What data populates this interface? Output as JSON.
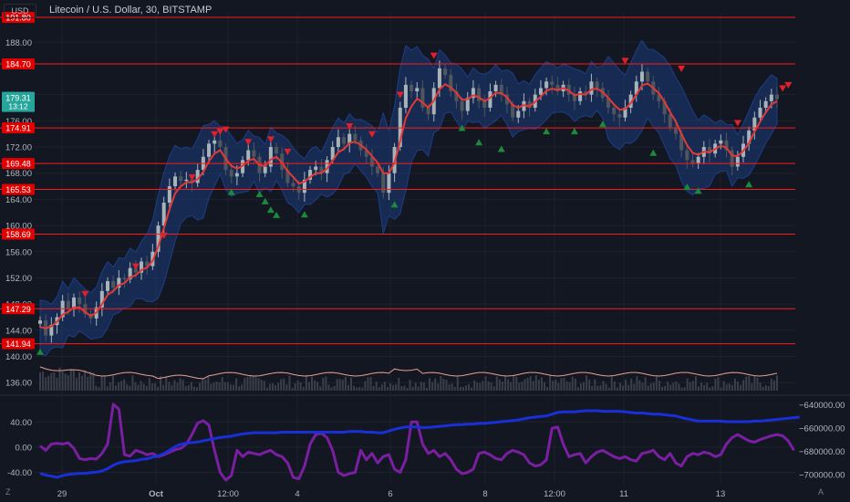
{
  "header": {
    "symbol_title": "Litecoin / U.S. Dollar, 30, BITSTAMP",
    "currency_button": "USD"
  },
  "footer": {
    "z_button": "Z",
    "a_button": "A"
  },
  "colors": {
    "background": "#131722",
    "grid": "#1e222d",
    "candle_up": "#a8b3b8",
    "candle_down": "#50555e",
    "ma_line": "#e53935",
    "band_fill": "#1c3c7a",
    "level_line": "#ff1a1a",
    "level_tag": "#e00000",
    "current_tag": "#26a69a",
    "osc_purple": "#7b1fa2",
    "osc_blue": "#1a2fd6",
    "volume_line": "#e8a090"
  },
  "chart_data": {
    "type": "line",
    "main_axis": {
      "ticks": [
        "188.00",
        "180.00",
        "176.00",
        "172.00",
        "168.00",
        "164.00",
        "160.00",
        "156.00",
        "152.00",
        "148.00",
        "144.00",
        "140.00",
        "136.00"
      ],
      "range": [
        134.5,
        192.5
      ]
    },
    "horizontal_levels": [
      191.8,
      184.7,
      174.91,
      169.48,
      165.53,
      158.69,
      147.29,
      141.94
    ],
    "current_price": {
      "value": "179.31",
      "countdown": "13:12"
    },
    "x_labels": [
      "29",
      "Oct",
      "12:00",
      "4",
      "6",
      "8",
      "12:00",
      "11",
      "13"
    ],
    "price_series": [
      145.5,
      143.2,
      144.8,
      146.0,
      148.5,
      147.2,
      149.0,
      148.0,
      146.5,
      145.8,
      147.5,
      150.0,
      151.5,
      150.5,
      152.0,
      151.8,
      153.5,
      152.8,
      154.5,
      153.8,
      156.0,
      160.0,
      163.5,
      166.0,
      167.5,
      166.8,
      167.0,
      166.5,
      168.5,
      170.5,
      172.5,
      173.0,
      172.0,
      168.5,
      167.5,
      168.0,
      170.0,
      171.5,
      170.5,
      168.0,
      169.0,
      172.0,
      171.0,
      168.5,
      166.5,
      166.0,
      165.0,
      167.0,
      168.5,
      169.0,
      168.0,
      170.0,
      172.0,
      173.5,
      172.5,
      174.0,
      173.0,
      171.5,
      170.5,
      169.0,
      168.0,
      165.0,
      168.0,
      172.0,
      178.0,
      181.5,
      180.5,
      181.0,
      178.0,
      177.0,
      181.0,
      184.0,
      183.0,
      180.5,
      179.0,
      177.5,
      179.5,
      181.0,
      179.0,
      178.0,
      180.5,
      181.5,
      180.0,
      178.5,
      176.5,
      177.5,
      179.0,
      178.0,
      180.0,
      181.0,
      182.0,
      181.5,
      180.5,
      181.5,
      180.0,
      179.0,
      180.5,
      180.0,
      182.0,
      181.0,
      179.5,
      178.0,
      177.0,
      176.5,
      178.0,
      180.0,
      182.0,
      183.5,
      182.0,
      180.0,
      179.0,
      177.0,
      175.0,
      174.0,
      171.5,
      170.0,
      169.5,
      170.5,
      172.0,
      171.0,
      172.5,
      173.0,
      171.5,
      169.0,
      170.5,
      172.5,
      174.5,
      176.5,
      178.0,
      179.0,
      180.0,
      179.3
    ],
    "ma_series": [
      144.5,
      144.3,
      144.6,
      145.3,
      146.4,
      146.8,
      147.5,
      147.5,
      146.8,
      146.2,
      146.7,
      148.0,
      149.4,
      150.0,
      150.9,
      151.2,
      152.1,
      152.4,
      153.2,
      153.6,
      154.6,
      156.8,
      159.6,
      162.5,
      164.9,
      166.0,
      166.6,
      166.6,
      167.1,
      168.2,
      169.8,
      171.0,
      171.5,
      170.2,
      169.1,
      168.7,
      169.1,
      169.9,
      170.2,
      169.2,
      169.1,
      170.1,
      170.5,
      169.6,
      168.3,
      167.4,
      166.4,
      166.7,
      167.4,
      168.0,
      168.0,
      168.7,
      169.9,
      171.2,
      171.7,
      172.6,
      172.8,
      172.3,
      171.6,
      170.6,
      169.6,
      168.0,
      168.0,
      169.6,
      172.9,
      176.4,
      178.2,
      179.4,
      178.8,
      178.0,
      179.1,
      180.8,
      181.6,
      181.1,
      180.3,
      179.2,
      179.3,
      179.9,
      179.6,
      179.0,
      179.5,
      180.3,
      180.2,
      179.6,
      178.4,
      178.0,
      178.4,
      178.2,
      178.9,
      179.7,
      180.6,
      180.9,
      180.7,
      181.0,
      180.6,
      179.9,
      180.1,
      180.0,
      180.8,
      180.9,
      180.4,
      179.5,
      178.5,
      177.7,
      177.8,
      178.7,
      180.0,
      181.4,
      181.7,
      181.0,
      180.2,
      178.9,
      177.3,
      175.9,
      174.0,
      172.3,
      171.1,
      170.8,
      171.3,
      171.2,
      171.7,
      172.2,
      171.9,
      170.7,
      170.6,
      171.4,
      172.6,
      174.3,
      175.9,
      177.3,
      178.5,
      179.0
    ],
    "markers": {
      "sell": [
        [
          8,
          149.6
        ],
        [
          17,
          153.8
        ],
        [
          22,
          158.5
        ],
        [
          27,
          167.4
        ],
        [
          31,
          174.0
        ],
        [
          32,
          174.4
        ],
        [
          33,
          174.7
        ],
        [
          37,
          172.8
        ],
        [
          41,
          173.2
        ],
        [
          44,
          171.3
        ],
        [
          55,
          175.2
        ],
        [
          59,
          174.0
        ],
        [
          64,
          180.0
        ],
        [
          70,
          186.0
        ],
        [
          104,
          185.2
        ],
        [
          114,
          184.0
        ],
        [
          124,
          175.7
        ],
        [
          132,
          181.0
        ],
        [
          133,
          181.5
        ]
      ],
      "buy": [
        [
          0,
          140.8
        ],
        [
          34,
          165.2
        ],
        [
          39,
          164.9
        ],
        [
          40,
          163.8
        ],
        [
          41,
          162.5
        ],
        [
          42,
          161.7
        ],
        [
          47,
          161.8
        ],
        [
          63,
          163.3
        ],
        [
          75,
          175.0
        ],
        [
          78,
          172.8
        ],
        [
          82,
          171.8
        ],
        [
          90,
          174.5
        ],
        [
          95,
          174.5
        ],
        [
          100,
          175.6
        ],
        [
          109,
          171.2
        ],
        [
          115,
          166.0
        ],
        [
          117,
          165.4
        ],
        [
          126,
          166.4
        ]
      ]
    },
    "osc_axis": {
      "ticks": [
        "40.00",
        "0.00",
        "-40.00"
      ],
      "range": [
        -58,
        78
      ]
    },
    "osc_right_axis": {
      "ticks": [
        "640000.00",
        "660000.00",
        "680000.00",
        "700000.00"
      ],
      "range": [
        -708000,
        -634000
      ]
    },
    "oscillator_series": [
      2,
      -5,
      5,
      6,
      5,
      7,
      -2,
      -18,
      -20,
      -18,
      -19,
      -10,
      5,
      68,
      60,
      -12,
      -14,
      -5,
      -8,
      -12,
      -10,
      -15,
      -12,
      -8,
      -4,
      -2,
      5,
      20,
      38,
      42,
      35,
      -5,
      -40,
      -52,
      -45,
      -5,
      -15,
      -8,
      -10,
      -12,
      -8,
      -5,
      -12,
      -15,
      -25,
      -48,
      -50,
      -30,
      5,
      20,
      22,
      15,
      -5,
      -40,
      -45,
      -42,
      -40,
      -5,
      -20,
      -10,
      -25,
      -15,
      -12,
      -35,
      -40,
      -20,
      40,
      40,
      5,
      -10,
      -5,
      -15,
      -10,
      -20,
      -35,
      -42,
      -40,
      -35,
      -10,
      -8,
      -12,
      -18,
      -20,
      -10,
      -5,
      -8,
      -12,
      -25,
      -30,
      -28,
      -20,
      30,
      32,
      5,
      -15,
      -12,
      -10,
      -25,
      -15,
      -8,
      -5,
      -10,
      -15,
      -18,
      -15,
      -20,
      -22,
      -10,
      -8,
      -5,
      -15,
      -20,
      -10,
      -25,
      -30,
      -15,
      -10,
      -12,
      -8,
      -10,
      -15,
      -12,
      5,
      15,
      20,
      15,
      10,
      8,
      12,
      15,
      18,
      20,
      18,
      10,
      -5
    ],
    "obv_series": [
      -699000,
      -700500,
      -701500,
      -702500,
      -701000,
      -700000,
      -699500,
      -699000,
      -699000,
      -698500,
      -698000,
      -697000,
      -695000,
      -692000,
      -690000,
      -689000,
      -688500,
      -688000,
      -687000,
      -686500,
      -685000,
      -684000,
      -682000,
      -679000,
      -676000,
      -674000,
      -673000,
      -672500,
      -672000,
      -671000,
      -670000,
      -669000,
      -668000,
      -667500,
      -667000,
      -666000,
      -665000,
      -664500,
      -664000,
      -664000,
      -664000,
      -664000,
      -664000,
      -663500,
      -663500,
      -663500,
      -663500,
      -663500,
      -663500,
      -663500,
      -663500,
      -663500,
      -663500,
      -663500,
      -663500,
      -663000,
      -663000,
      -663000,
      -663500,
      -663500,
      -664000,
      -664000,
      -662500,
      -661000,
      -660000,
      -659000,
      -659000,
      -659000,
      -659500,
      -659500,
      -659000,
      -658500,
      -658000,
      -657500,
      -657000,
      -657000,
      -656500,
      -656500,
      -656000,
      -656000,
      -655500,
      -655000,
      -654500,
      -654000,
      -653500,
      -653000,
      -652000,
      -651000,
      -650500,
      -650000,
      -649500,
      -648000,
      -646500,
      -646000,
      -646000,
      -646000,
      -645500,
      -645000,
      -645000,
      -645000,
      -645500,
      -645500,
      -645500,
      -645500,
      -646000,
      -646500,
      -647000,
      -647000,
      -647500,
      -648000,
      -648000,
      -648500,
      -649000,
      -649500,
      -651000,
      -652000,
      -653000,
      -654000,
      -654000,
      -654000,
      -654000,
      -654000,
      -654500,
      -654500,
      -654500,
      -654500,
      -654500,
      -654000,
      -654000,
      -653500,
      -653000,
      -652500,
      -652000,
      -651500,
      -651000,
      -650500
    ]
  }
}
